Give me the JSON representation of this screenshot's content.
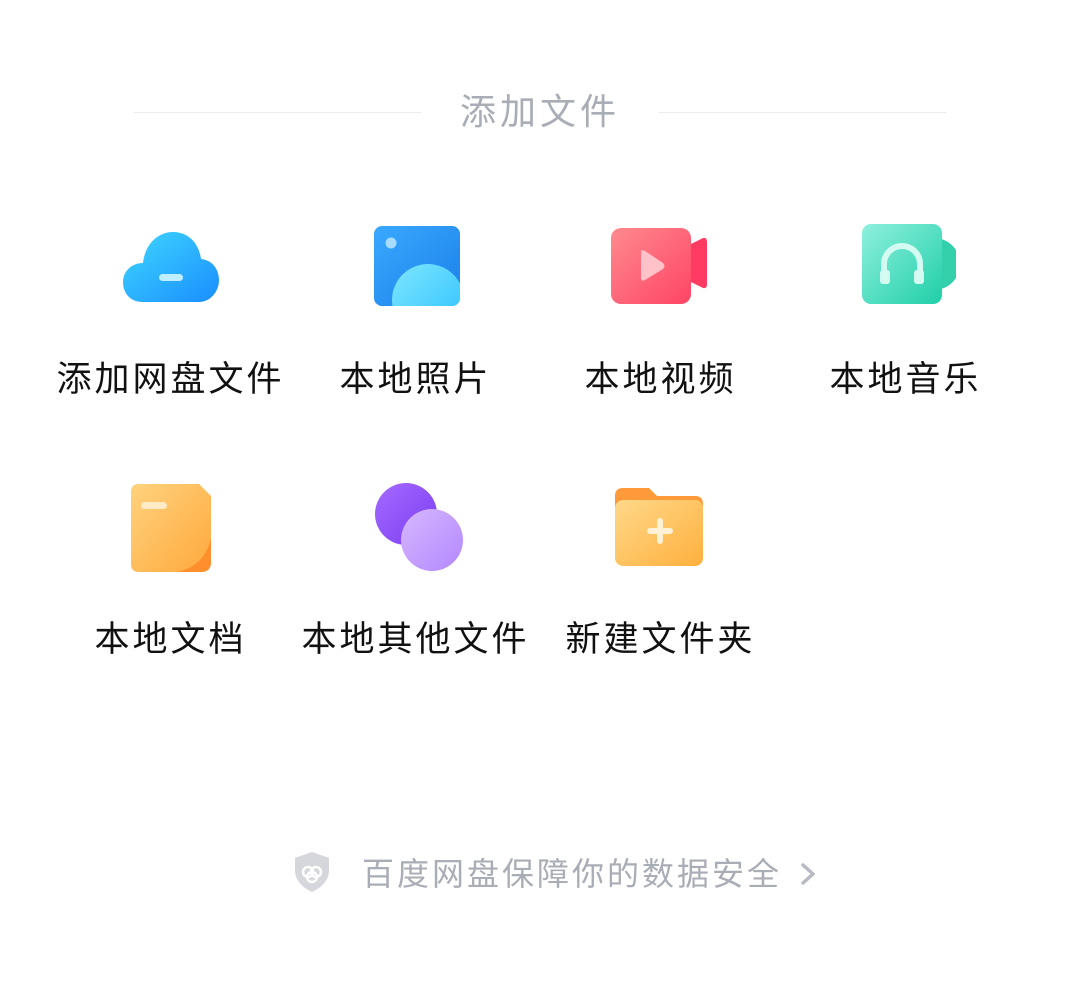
{
  "header": {
    "title": "添加文件"
  },
  "items": [
    {
      "label": "添加网盘文件",
      "icon": "cloud-icon",
      "color": "#1aa7ff"
    },
    {
      "label": "本地照片",
      "icon": "photo-icon",
      "color": "#2a9dff"
    },
    {
      "label": "本地视频",
      "icon": "video-camera-icon",
      "color": "#ff4f6f"
    },
    {
      "label": "本地音乐",
      "icon": "headphones-icon",
      "color": "#2fd6b4"
    },
    {
      "label": "本地文档",
      "icon": "document-icon",
      "color": "#ffb23f"
    },
    {
      "label": "本地其他文件",
      "icon": "bubbles-icon",
      "color": "#9f6bff"
    },
    {
      "label": "新建文件夹",
      "icon": "folder-plus-icon",
      "color": "#ffb347"
    }
  ],
  "footer": {
    "text": "百度网盘保障你的数据安全",
    "icon": "shield-icon",
    "chevron": "chevron-right-icon"
  },
  "colors": {
    "muted_text": "#a9adb6",
    "primary_text": "#111111",
    "divider": "#ececee"
  }
}
